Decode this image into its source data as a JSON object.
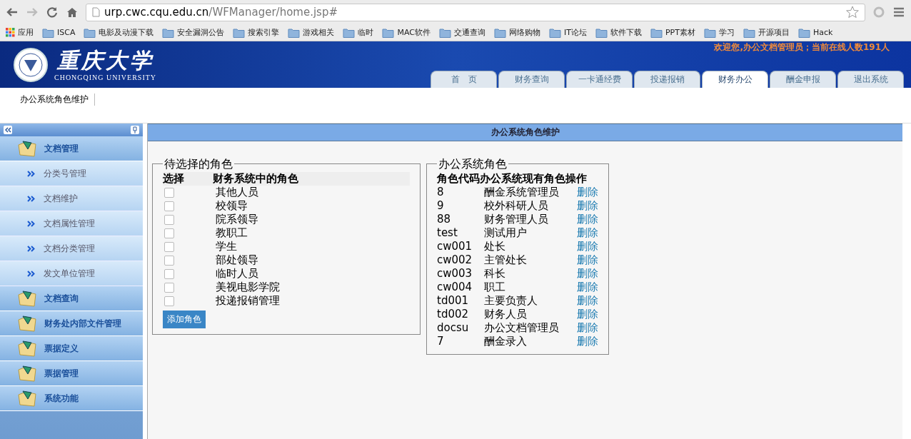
{
  "browser": {
    "url_host": "urp.cwc.cqu.edu.cn",
    "url_path": "/WFManager/home.jsp#",
    "bookmarks": [
      {
        "kind": "apps",
        "label": "应用"
      },
      {
        "kind": "folder",
        "label": "ISCA"
      },
      {
        "kind": "folder",
        "label": "电影及动漫下载"
      },
      {
        "kind": "folder",
        "label": "安全漏洞公告"
      },
      {
        "kind": "folder",
        "label": "搜索引擎"
      },
      {
        "kind": "folder",
        "label": "游戏相关"
      },
      {
        "kind": "folder",
        "label": "临时"
      },
      {
        "kind": "folder",
        "label": "MAC软件"
      },
      {
        "kind": "folder",
        "label": "交通查询"
      },
      {
        "kind": "folder",
        "label": "网络购物"
      },
      {
        "kind": "folder",
        "label": "IT论坛"
      },
      {
        "kind": "folder",
        "label": "软件下载"
      },
      {
        "kind": "folder",
        "label": "PPT素材"
      },
      {
        "kind": "folder",
        "label": "学习"
      },
      {
        "kind": "folder",
        "label": "开源项目"
      },
      {
        "kind": "folder",
        "label": "Hack"
      }
    ]
  },
  "header": {
    "logo_title": "重庆大学",
    "logo_subtitle": "CHONGQING UNIVERSITY",
    "welcome": "欢迎您,办公文档管理员；当前在线人数191人",
    "tabs": [
      {
        "label": "首　页",
        "selected": false
      },
      {
        "label": "财务查询",
        "selected": false
      },
      {
        "label": "一卡通经费",
        "selected": false
      },
      {
        "label": "投递报销",
        "selected": false
      },
      {
        "label": "财务办公",
        "selected": true
      },
      {
        "label": "酬金申报",
        "selected": false
      },
      {
        "label": "退出系统",
        "selected": false
      }
    ]
  },
  "breadcrumb": "办公系统角色维护",
  "sidebar": {
    "items": [
      {
        "label": "文档管理",
        "children": [
          {
            "label": "分类号管理"
          },
          {
            "label": "文档维护"
          },
          {
            "label": "文档属性管理"
          },
          {
            "label": "文档分类管理"
          },
          {
            "label": "发文单位管理"
          }
        ]
      },
      {
        "label": "文档查询"
      },
      {
        "label": "财务处内部文件管理"
      },
      {
        "label": "票据定义"
      },
      {
        "label": "票据管理"
      },
      {
        "label": "系统功能"
      }
    ]
  },
  "panel": {
    "title": "办公系统角色维护",
    "candidates": {
      "legend": "待选择的角色",
      "columns": [
        "选择",
        "财务系统中的角色"
      ],
      "rows": [
        {
          "name": "其他人员",
          "checked": false
        },
        {
          "name": "校领导",
          "checked": false
        },
        {
          "name": "院系领导",
          "checked": false
        },
        {
          "name": "教职工",
          "checked": false
        },
        {
          "name": "学生",
          "checked": false
        },
        {
          "name": "部处领导",
          "checked": false
        },
        {
          "name": "临时人员",
          "checked": false
        },
        {
          "name": "美视电影学院",
          "checked": false
        },
        {
          "name": "投递报销管理",
          "checked": false
        }
      ],
      "button": "添加角色"
    },
    "roles": {
      "legend": "办公系统角色",
      "columns": [
        "角色代码",
        "办公系统现有角色",
        "操作"
      ],
      "rows": [
        {
          "code": "8",
          "name": "酬金系统管理员",
          "action": "删除"
        },
        {
          "code": "9",
          "name": "校外科研人员",
          "action": "删除"
        },
        {
          "code": "88",
          "name": "财务管理人员",
          "action": "删除"
        },
        {
          "code": "test",
          "name": "测试用户",
          "action": "删除"
        },
        {
          "code": "cw001",
          "name": "处长",
          "action": "删除"
        },
        {
          "code": "cw002",
          "name": "主管处长",
          "action": "删除"
        },
        {
          "code": "cw003",
          "name": "科长",
          "action": "删除"
        },
        {
          "code": "cw004",
          "name": "职工",
          "action": "删除"
        },
        {
          "code": "td001",
          "name": "主要负责人",
          "action": "删除"
        },
        {
          "code": "td002",
          "name": "财务人员",
          "action": "删除"
        },
        {
          "code": "docsu",
          "name": "办公文档管理员",
          "action": "删除"
        },
        {
          "code": "7",
          "name": "酬金录入",
          "action": "删除"
        }
      ]
    }
  }
}
